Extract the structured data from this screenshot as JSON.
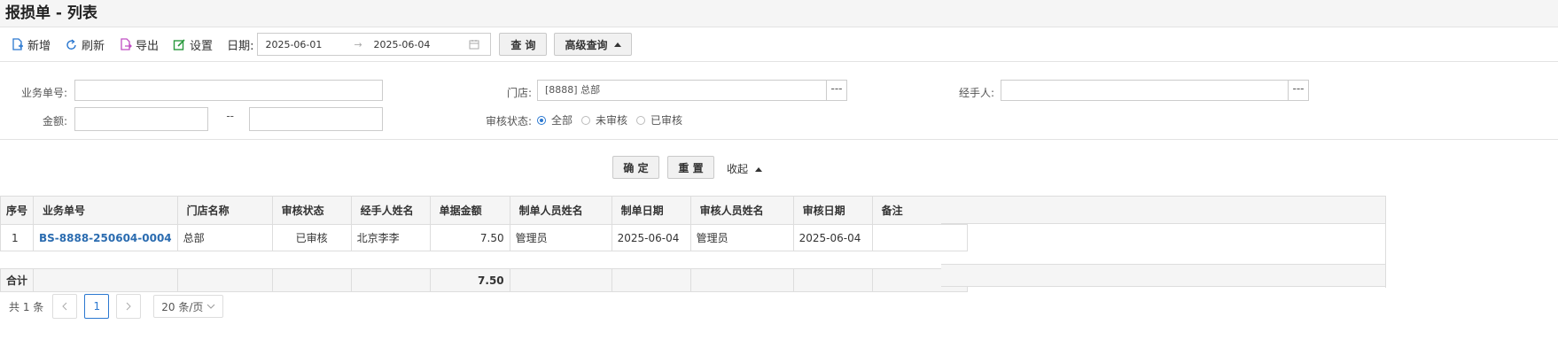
{
  "title": "报损单 - 列表",
  "toolbar": {
    "new_label": "新增",
    "refresh_label": "刷新",
    "export_label": "导出",
    "settings_label": "设置",
    "date_label": "日期:",
    "date_from": "2025-06-01",
    "date_to": "2025-06-04",
    "query_label": "查 询",
    "advanced_label": "高级查询"
  },
  "filter": {
    "order_no_label": "业务单号:",
    "order_no_value": "",
    "store_label": "门店:",
    "store_value": "[8888] 总部",
    "handler_label": "经手人:",
    "handler_value": "",
    "amount_label": "金额:",
    "amount_sep": "--",
    "audit_label": "审核状态:",
    "audit_options": [
      "全部",
      "未审核",
      "已审核"
    ],
    "audit_selected": "全部",
    "picker_label": "---"
  },
  "actions": {
    "confirm_label": "确 定",
    "reset_label": "重 置",
    "collapse_label": "收起"
  },
  "table": {
    "columns": [
      "序号",
      "业务单号",
      "门店名称",
      "审核状态",
      "经手人姓名",
      "单据金额",
      "制单人员姓名",
      "制单日期",
      "审核人员姓名",
      "审核日期",
      "备注"
    ],
    "rows": [
      [
        "1",
        "BS-8888-250604-0004",
        "总部",
        "已审核",
        "北京李李",
        "7.50",
        "管理员",
        "2025-06-04",
        "管理员",
        "2025-06-04",
        ""
      ]
    ],
    "total_label": "合计",
    "total_amount": "7.50"
  },
  "pager": {
    "total_text": "共 1 条",
    "current_page": "1",
    "page_size_text": "20 条/页"
  },
  "colors": {
    "link": "#2b6cb0",
    "icon_blue": "#2b78d0",
    "icon_purple": "#c04fc4",
    "icon_green": "#2a9a3e"
  }
}
